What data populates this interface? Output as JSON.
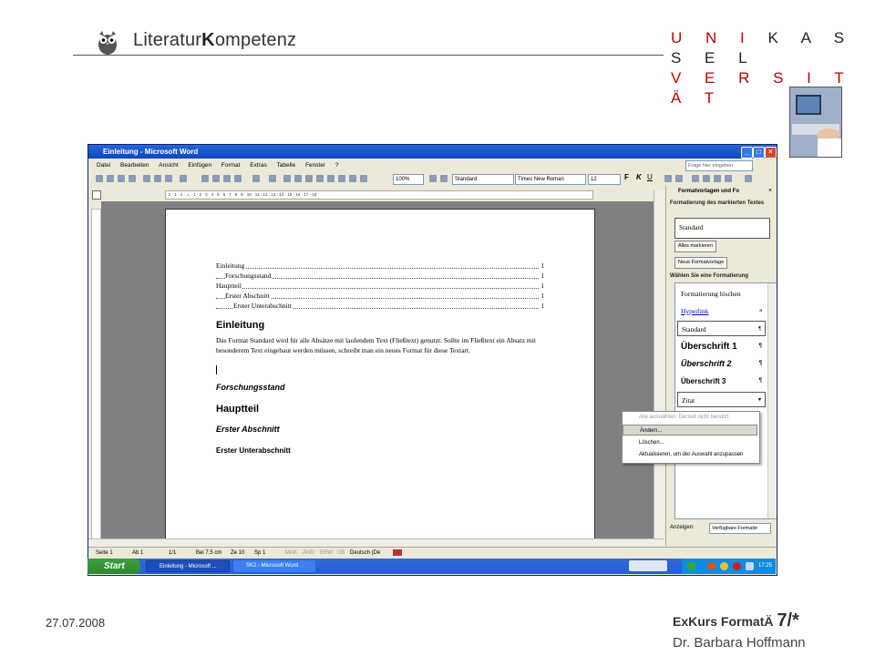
{
  "slide": {
    "brand_prefix": "Literatur",
    "brand_mid": "K",
    "brand_suffix": "ompetenz",
    "uni_line1_a": "U N I",
    "uni_line1_b": "K A S S E L",
    "uni_line2_a": "V E R S I T",
    "uni_line2_b": "Ä T",
    "date": "27.07.2008",
    "footer_title": "ExKurs FormatÄ",
    "footer_page": "7/*",
    "footer_author": "Dr. Barbara Hoffmann"
  },
  "window": {
    "title": "Einleitung - Microsoft Word",
    "menu": [
      "Datei",
      "Bearbeiten",
      "Ansicht",
      "Einfügen",
      "Format",
      "Extras",
      "Tabelle",
      "Fenster",
      "?"
    ],
    "question_placeholder": "Frage hier eingeben",
    "zoom": "100%",
    "style": "Standard",
    "font": "Times New Roman",
    "font_size": "12",
    "ruler_text": "· 2 · 1 · 1 · ⊥ · 1 · 2 · 3 · 4 · 5 · 6 · 7 · 8 · 9 · 10 · 11 · 12 · 13 · 14 · 15 · 16 · 17 · 18 ·"
  },
  "document": {
    "toc": [
      {
        "label": "Einleitung",
        "page": "1"
      },
      {
        "label": "Forschungsstand",
        "page": "1"
      },
      {
        "label": "Hauptteil",
        "page": "1"
      },
      {
        "label": "Erster Abschnitt",
        "page": "1"
      },
      {
        "label": "Erster Unterabschnitt",
        "page": "1"
      }
    ],
    "heading1": "Einleitung",
    "body": "Das Format Standard wird für alle Absätze mit laufendem Text (Fließtext) genutzt. Sollte im Fließtext ein Absatz mit besonderem Text eingebaut werden müssen, schreibt man ein neues Format für diese Textart.",
    "heading_forschung": "Forschungsstand",
    "heading_haupt": "Hauptteil",
    "heading_abschnitt": "Erster Abschnitt",
    "heading_unter": "Erster Unterabschnitt"
  },
  "status": {
    "seite": "Seite 1",
    "ab": "Ab 1",
    "pages": "1/1",
    "bei": "Bei 7,5 cm",
    "ze": "Ze 10",
    "sp": "Sp 1",
    "mak": "MAK",
    "aend": "ÄND",
    "erw": "ERW",
    "ub": "ÜB",
    "lang": "Deutsch (De"
  },
  "pane": {
    "title": "Formatvorlagen und Fo",
    "section_marked": "Formatierung des markierten Textes",
    "current_format": "Standard",
    "btn_select_all": "Alles markieren",
    "btn_new_style": "Neue Formatvorlage",
    "section_choose": "Wählen Sie eine Formatierung",
    "formats": [
      {
        "label": "Formatierung löschen",
        "mark": ""
      },
      {
        "label": "Hyperlink",
        "mark": "a"
      },
      {
        "label": "Standard",
        "mark": "¶"
      },
      {
        "label": "Überschrift 1",
        "mark": "¶"
      },
      {
        "label": "Überschrift 2",
        "mark": "¶"
      },
      {
        "label": "Überschrift 3",
        "mark": "¶"
      },
      {
        "label": "Zitat",
        "mark": "▾"
      }
    ],
    "show_label": "Anzeigen:",
    "show_value": "Verfügbare Formatie"
  },
  "context_menu": [
    "Alle auswählen: Derzeit nicht benutzt",
    "Ändern...",
    "Löschen...",
    "Aktualisieren, um der Auswahl anzupassen"
  ],
  "taskbar": {
    "start": "Start",
    "task1": "Einleitung - Microsoft ...",
    "task2": "SK2 - Microsoft Word",
    "clock": "17:25"
  }
}
